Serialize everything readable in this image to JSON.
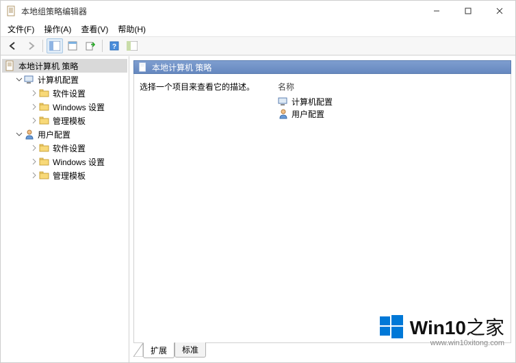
{
  "window": {
    "title": "本地组策略编辑器"
  },
  "menu": {
    "file": "文件(F)",
    "action": "操作(A)",
    "view": "查看(V)",
    "help": "帮助(H)"
  },
  "tree": {
    "root": "本地计算机 策略",
    "computer_config": "计算机配置",
    "software_settings": "软件设置",
    "windows_settings": "Windows 设置",
    "admin_templates": "管理模板",
    "user_config": "用户配置"
  },
  "content": {
    "header": "本地计算机 策略",
    "desc": "选择一个项目来查看它的描述。",
    "col_name": "名称",
    "item_computer": "计算机配置",
    "item_user": "用户配置"
  },
  "tabs": {
    "extended": "扩展",
    "standard": "标准"
  },
  "watermark": {
    "brand": "Win10",
    "suffix": "之家",
    "url": "www.win10xitong.com"
  }
}
